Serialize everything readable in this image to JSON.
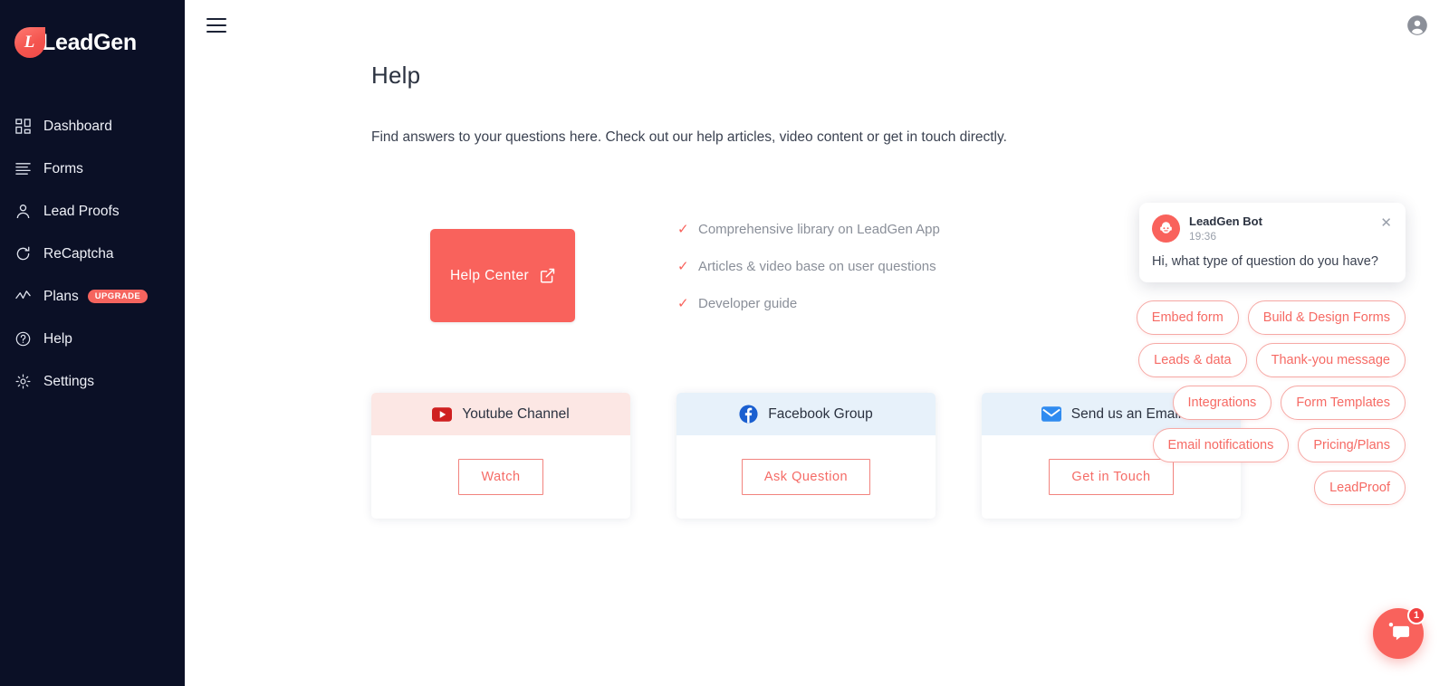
{
  "brand": {
    "logo_letter": "L",
    "name": "LeadGen"
  },
  "sidebar": {
    "items": [
      {
        "label": "Dashboard",
        "icon": "dashboard-grid-icon"
      },
      {
        "label": "Forms",
        "icon": "list-lines-icon"
      },
      {
        "label": "Lead Proofs",
        "icon": "person-icon"
      },
      {
        "label": "ReCaptcha",
        "icon": "refresh-circle-icon"
      },
      {
        "label": "Plans",
        "icon": "trend-line-icon",
        "badge": "UPGRADE"
      },
      {
        "label": "Help",
        "icon": "question-circle-icon"
      },
      {
        "label": "Settings",
        "icon": "gear-icon"
      }
    ]
  },
  "topbar": {
    "menu_icon": "hamburger-icon",
    "account_icon": "account-circle-icon"
  },
  "page": {
    "title": "Help",
    "subtitle": "Find answers to your questions here. Check out our help articles, video content or get in touch directly."
  },
  "help_center": {
    "label": "Help  Center",
    "icon": "external-link-icon"
  },
  "checklist": [
    "Comprehensive library on LeadGen App",
    "Articles & video base on user questions",
    "Developer guide"
  ],
  "cards": [
    {
      "title": "Youtube Channel",
      "icon": "youtube-icon",
      "button": "Watch",
      "head_color": "#fce7e4"
    },
    {
      "title": "Facebook Group",
      "icon": "facebook-icon",
      "button": "Ask  Question",
      "head_color": "#e7f1fa"
    },
    {
      "title": "Send us an Email",
      "icon": "email-icon",
      "button": "Get  in  Touch",
      "head_color": "#e7f1fa"
    }
  ],
  "chat": {
    "bot_name": "LeadGen Bot",
    "time": "19:36",
    "message": "Hi, what type of question do you have?",
    "close_icon": "close-icon",
    "avatar_icon": "bot-avatar-icon",
    "quick_replies": [
      "Embed form",
      "Build & Design Forms",
      "Leads & data",
      "Thank-you message",
      "Integrations",
      "Form Templates",
      "Email notifications",
      "Pricing/Plans",
      "LeadProof"
    ],
    "launcher": {
      "icon": "chat-bubble-icon",
      "badge": "1"
    }
  },
  "colors": {
    "accent": "#f9625c",
    "sidebar_bg": "#0b1026",
    "card_pink": "#fce7e4",
    "card_blue": "#e7f1fa"
  }
}
